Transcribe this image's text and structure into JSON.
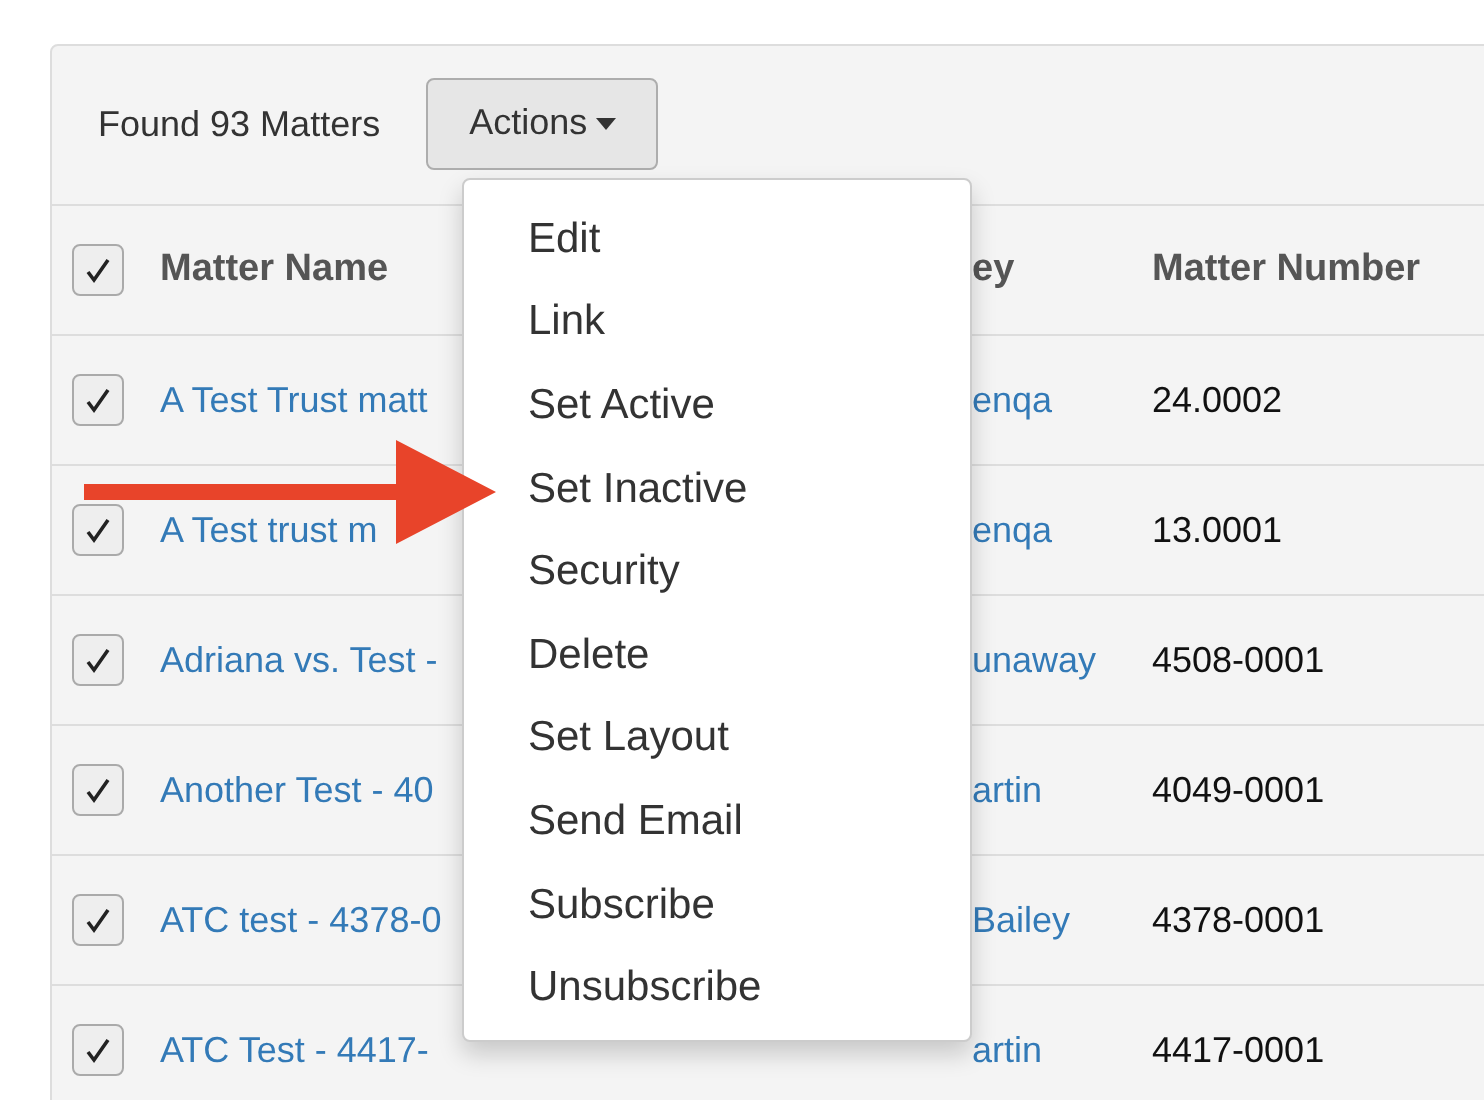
{
  "toolbar": {
    "count_label": "Found 93 Matters",
    "actions_button": {
      "label": "Actions",
      "expanded": true
    }
  },
  "actions_menu": [
    "Edit",
    "Link",
    "Set Active",
    "Set Inactive",
    "Security",
    "Delete",
    "Set Layout",
    "Send Email",
    "Subscribe",
    "Unsubscribe"
  ],
  "table": {
    "select_all_checked": true,
    "columns": [
      "Matter Name",
      "ey",
      "Matter Number"
    ],
    "rows": [
      {
        "checked": true,
        "name": "A Test Trust matt",
        "column_3": "enqa",
        "number": "24.0002"
      },
      {
        "checked": true,
        "name": "A Test trust m",
        "column_3": "enqa",
        "number": "13.0001"
      },
      {
        "checked": true,
        "name": "Adriana vs. Test -",
        "column_3": "unaway",
        "number": "4508-0001"
      },
      {
        "checked": true,
        "name": "Another Test - 40",
        "column_3": "artin",
        "number": "4049-0001"
      },
      {
        "checked": true,
        "name": "ATC test - 4378-0",
        "column_3": "Bailey",
        "number": "4378-0001"
      },
      {
        "checked": true,
        "name": "ATC Test - 4417-",
        "column_3": "artin",
        "number": "4417-0001"
      }
    ]
  }
}
